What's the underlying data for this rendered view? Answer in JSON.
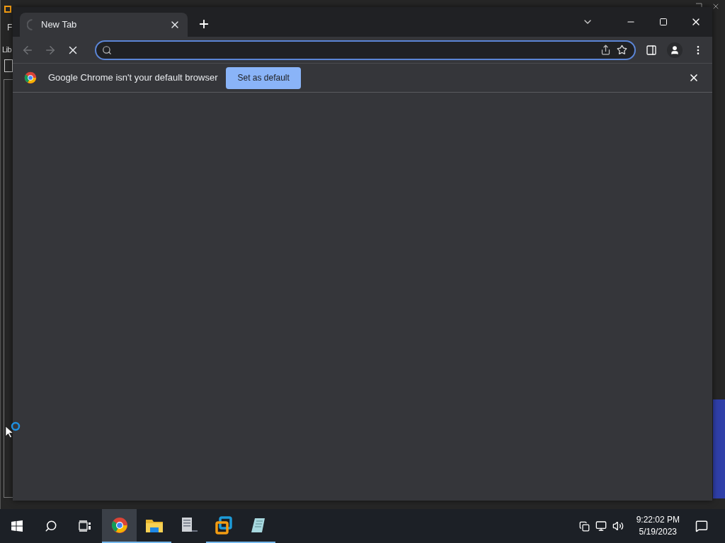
{
  "background_window": {
    "menu_text": "F",
    "library_label": "Lib"
  },
  "browser": {
    "tabs": [
      {
        "title": "New Tab",
        "selected": true,
        "loading": true
      }
    ],
    "address": {
      "focused": true
    },
    "loading": true,
    "infobar": {
      "message": "Google Chrome isn't your default browser",
      "button": "Set as default"
    }
  },
  "taskbar": {
    "apps": [
      {
        "kind": "chrome",
        "selected": true,
        "running": true
      },
      {
        "kind": "folder",
        "selected": false,
        "running": true
      },
      {
        "kind": "document",
        "selected": false,
        "running": false
      },
      {
        "kind": "vmware",
        "selected": false,
        "running": true
      },
      {
        "kind": "notepad",
        "selected": false,
        "running": true
      }
    ],
    "clock": {
      "time": "9:22:02 PM",
      "date": "5/19/2023"
    }
  }
}
